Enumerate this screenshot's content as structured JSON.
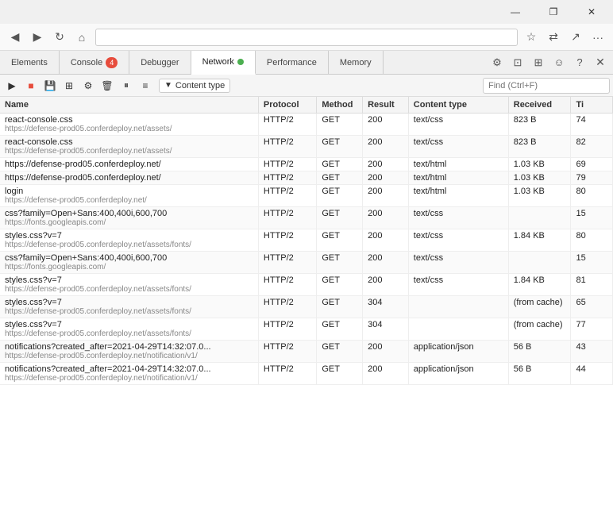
{
  "titleBar": {
    "minimizeLabel": "—",
    "restoreLabel": "❐",
    "closeLabel": "✕"
  },
  "browserToolbar": {
    "icons": [
      "◁",
      "▷",
      "↺",
      "🏠",
      "🔒"
    ]
  },
  "tabs": [
    {
      "id": "elements",
      "label": "Elements",
      "active": false,
      "badge": null
    },
    {
      "id": "console",
      "label": "Console",
      "active": false,
      "badge": "4"
    },
    {
      "id": "debugger",
      "label": "Debugger",
      "active": false,
      "badge": null
    },
    {
      "id": "network",
      "label": "Network",
      "active": true,
      "badge": null,
      "dot": true
    },
    {
      "id": "performance",
      "label": "Performance",
      "active": false,
      "badge": null
    },
    {
      "id": "memory",
      "label": "Memory",
      "active": false,
      "badge": null
    }
  ],
  "toolbar": {
    "filterLabel": "Content type",
    "searchPlaceholder": "Find (Ctrl+F)"
  },
  "table": {
    "headers": [
      "Name",
      "Protocol",
      "Method",
      "Result",
      "Content type",
      "Received",
      "Ti"
    ],
    "rows": [
      {
        "name": "react-console.css",
        "sub": "https://defense-prod05.conferdeploy.net/assets/",
        "protocol": "HTTP/2",
        "method": "GET",
        "result": "200",
        "contentType": "text/css",
        "received": "823 B",
        "time": "74"
      },
      {
        "name": "react-console.css",
        "sub": "https://defense-prod05.conferdeploy.net/assets/",
        "protocol": "HTTP/2",
        "method": "GET",
        "result": "200",
        "contentType": "text/css",
        "received": "823 B",
        "time": "82"
      },
      {
        "name": "https://defense-prod05.conferdeploy.net/",
        "sub": "",
        "protocol": "HTTP/2",
        "method": "GET",
        "result": "200",
        "contentType": "text/html",
        "received": "1.03 KB",
        "time": "69"
      },
      {
        "name": "https://defense-prod05.conferdeploy.net/",
        "sub": "",
        "protocol": "HTTP/2",
        "method": "GET",
        "result": "200",
        "contentType": "text/html",
        "received": "1.03 KB",
        "time": "79"
      },
      {
        "name": "login",
        "sub": "https://defense-prod05.conferdeploy.net/",
        "protocol": "HTTP/2",
        "method": "GET",
        "result": "200",
        "contentType": "text/html",
        "received": "1.03 KB",
        "time": "80"
      },
      {
        "name": "css?family=Open+Sans:400,400i,600,700",
        "sub": "https://fonts.googleapis.com/",
        "protocol": "HTTP/2",
        "method": "GET",
        "result": "200",
        "contentType": "text/css",
        "received": "",
        "time": "15"
      },
      {
        "name": "styles.css?v=7",
        "sub": "https://defense-prod05.conferdeploy.net/assets/fonts/",
        "protocol": "HTTP/2",
        "method": "GET",
        "result": "200",
        "contentType": "text/css",
        "received": "1.84 KB",
        "time": "80"
      },
      {
        "name": "css?family=Open+Sans:400,400i,600,700",
        "sub": "https://fonts.googleapis.com/",
        "protocol": "HTTP/2",
        "method": "GET",
        "result": "200",
        "contentType": "text/css",
        "received": "",
        "time": "15"
      },
      {
        "name": "styles.css?v=7",
        "sub": "https://defense-prod05.conferdeploy.net/assets/fonts/",
        "protocol": "HTTP/2",
        "method": "GET",
        "result": "200",
        "contentType": "text/css",
        "received": "1.84 KB",
        "time": "81"
      },
      {
        "name": "styles.css?v=7",
        "sub": "https://defense-prod05.conferdeploy.net/assets/fonts/",
        "protocol": "HTTP/2",
        "method": "GET",
        "result": "304",
        "contentType": "",
        "received": "(from cache)",
        "time": "65"
      },
      {
        "name": "styles.css?v=7",
        "sub": "https://defense-prod05.conferdeploy.net/assets/fonts/",
        "protocol": "HTTP/2",
        "method": "GET",
        "result": "304",
        "contentType": "",
        "received": "(from cache)",
        "time": "77"
      },
      {
        "name": "notifications?created_after=2021-04-29T14:32:07.0...",
        "sub": "https://defense-prod05.conferdeploy.net/notification/v1/",
        "protocol": "HTTP/2",
        "method": "GET",
        "result": "200",
        "contentType": "application/json",
        "received": "56 B",
        "time": "43"
      },
      {
        "name": "notifications?created_after=2021-04-29T14:32:07.0...",
        "sub": "https://defense-prod05.conferdeploy.net/notification/v1/",
        "protocol": "HTTP/2",
        "method": "GET",
        "result": "200",
        "contentType": "application/json",
        "received": "56 B",
        "time": "44"
      }
    ]
  }
}
